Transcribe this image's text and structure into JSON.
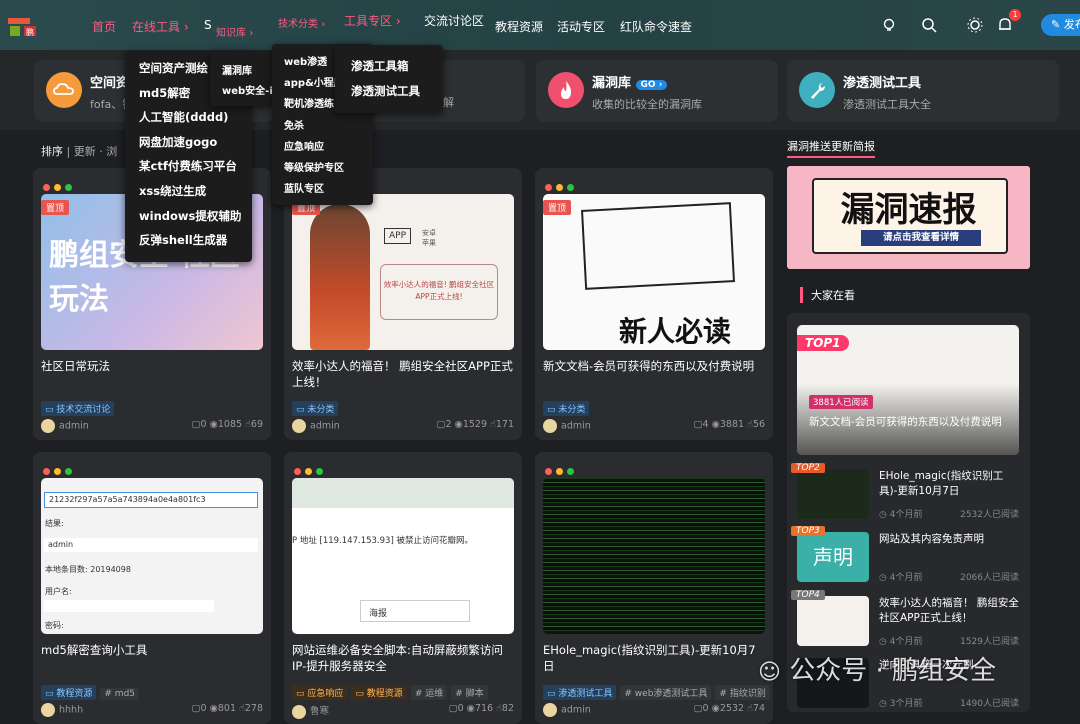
{
  "nav": {
    "items": [
      "首页",
      "在线工具",
      "知识库",
      "技术分类",
      "工具专区",
      "交流讨论区",
      "教程资源",
      "活动专区",
      "红队命令速查"
    ],
    "notif_count": "1",
    "publish_label": "发布",
    "chev": "›"
  },
  "quick_cards": [
    {
      "title": "空间资",
      "sub": "fofa、钟"
    },
    {
      "title": "",
      "sub": "解"
    },
    {
      "title": "漏洞库",
      "badge": "GO",
      "sub": "收集的比较全的漏洞库"
    },
    {
      "title": "渗透测试工具",
      "sub": "渗透测试工具大全"
    }
  ],
  "sort": {
    "label": "排序",
    "update": "更新",
    "more": "浏"
  },
  "menus": {
    "online_tools": [
      "空间资产测绘",
      "md5解密",
      "人工智能(dddd)",
      "网盘加速gogo",
      "某ctf付费练习平台",
      "xss绕过生成",
      "windows提权辅助",
      "反弹shell生成器"
    ],
    "knowledge": [
      "漏洞库",
      "web安全-i"
    ],
    "tech": [
      "web渗透",
      "app&小程序",
      "靶机渗透练",
      "免杀",
      "应急响应",
      "等级保护专区",
      "蓝队专区"
    ],
    "tools": [
      "渗透工具箱",
      "渗透测试工具"
    ]
  },
  "cards": [
    {
      "pin": "置顶",
      "title": "社区日常玩法",
      "thumb_text": "鹏组安全 社区玩法",
      "tags": [
        "技术交流讨论"
      ],
      "author": "admin",
      "comments": "0",
      "views": "1085",
      "likes": "69"
    },
    {
      "pin": "置顶",
      "title": "效率小达人的福音！ 鹏组安全社区APP正式上线！",
      "thumb_text": "效率小达人的福音! 鹏组安全社区APP正式上线!",
      "thumb_app": "APP",
      "thumb_ios": "安卓 苹果",
      "tags": [
        "未分类"
      ],
      "author": "admin",
      "comments": "2",
      "views": "1529",
      "likes": "171"
    },
    {
      "pin": "置顶",
      "title": "新文文档-会员可获得的东西以及付费说明",
      "thumb_text": "新人必读",
      "tags": [
        "未分类"
      ],
      "author": "admin",
      "comments": "4",
      "views": "3881",
      "likes": "56"
    },
    {
      "title": "md5解密查询小工具",
      "hash": "21232f297a57a5a743894a0e4a801fc3",
      "result_label": "结果:",
      "result": "admin",
      "count": "本地条目数: 20194098",
      "user_label": "用户名:",
      "pass_label": "密码:",
      "tags": [
        "教程资源",
        "# md5"
      ],
      "author": "hhhh",
      "comments": "0",
      "views": "801",
      "likes": "278"
    },
    {
      "title": "网站运维必备安全脚本:自动屏蔽频繁访问IP-提升服务器安全",
      "thumb_text": "P 地址 [119.147.153.93] 被禁止访问花瓣网。",
      "thumb_btn": "海报",
      "tags": [
        "应急响应",
        "教程资源",
        "# 运维",
        "# 脚本"
      ],
      "author": "鲁寒",
      "comments": "0",
      "views": "716",
      "likes": "82"
    },
    {
      "title": "EHole_magic(指纹识别工具)-更新10月7日",
      "tags": [
        "渗透测试工具",
        "# web渗透测试工具",
        "# 指纹识别"
      ],
      "author": "admin",
      "comments": "0",
      "views": "2532",
      "likes": "74"
    }
  ],
  "sidebar": {
    "vuln_title": "漏洞推送更新简报",
    "banner_title": "漏洞速报",
    "banner_sub": "请点击我查看详情",
    "hot_title": "大家在看",
    "top1": {
      "rank": "TOP1",
      "badge": "3881人已阅读",
      "title": "新文文档-会员可获得的东西以及付费说明"
    },
    "list": [
      {
        "rank": "TOP2",
        "title": "EHole_magic(指纹识别工具)-更新10月7日",
        "time": "4个月前",
        "reads": "2532人已阅读"
      },
      {
        "rank": "TOP3",
        "title": "网站及其内容免责声明",
        "thumb": "声明",
        "time": "4个月前",
        "reads": "2066人已阅读"
      },
      {
        "rank": "TOP4",
        "title": "效率小达人的福音！ 鹏组安全社区APP正式上线！",
        "time": "4个月前",
        "reads": "1529人已阅读"
      },
      {
        "rank": "",
        "title": "逆向工具箱一次元刷",
        "time": "3个月前",
        "reads": "1490人已阅读"
      }
    ]
  },
  "watermark": "公众号 · 鹏组安全"
}
